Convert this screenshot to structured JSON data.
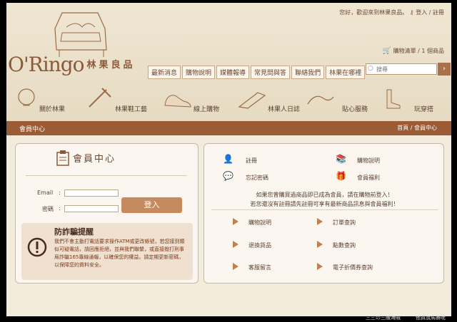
{
  "top": {
    "welcome": "您好，歡迎來到林果良品。",
    "login_link": "登入",
    "register_link": "註冊",
    "sep": "/"
  },
  "cart": {
    "text": "購物清單 / 1 個商品"
  },
  "logo": {
    "en": "O'Ringo",
    "zh": "林果良品"
  },
  "nav": [
    "最新消息",
    "購物說明",
    "媒體報導",
    "常見問與答",
    "聯絡我們",
    "林果在哪裡"
  ],
  "search": {
    "placeholder": "搜尋"
  },
  "categories": [
    "關於林果",
    "林果鞋工藝",
    "線上購物",
    "林果人日誌",
    "貼心服務",
    "玩穿搭"
  ],
  "section": {
    "title": "會員中心",
    "crumb": "首頁 / 會員中心"
  },
  "member": {
    "title": "會員中心",
    "email_label": "Email",
    "pwd_label": "密碼",
    "colon": ":",
    "login_btn": "登入"
  },
  "fraud": {
    "title": "防詐騙提醒",
    "body": "我們不會主動打電話要求操作ATM或更改帳號，若您接到類似可疑電話，請回應拒絕，並與我們聯繫，或直接撥打刑事局詐騙165專線通報，以確保您的權益。請定期更新密碼，以保障您的資料安全。"
  },
  "links_top": [
    "註冊",
    "忘記密碼",
    "購物說明",
    "會員福利"
  ],
  "notice": [
    "如果您曾購買過商品即已成為會員，請在購物前登入！",
    "若您還沒有註冊請先註冊可享有最新商品訊息與會員福利！"
  ],
  "links_bottom": [
    "購物說明",
    "訂單查詢",
    "退換貨品",
    "點數查詢",
    "客服留言",
    "電子折價券查詢"
  ],
  "footer": {
    "left": "三三の三艘海賊",
    "right": "他買說馬賽呢"
  },
  "colors": {
    "accent": "#9b5b34",
    "button": "#c58b5f",
    "background": "#f3ecdc"
  }
}
